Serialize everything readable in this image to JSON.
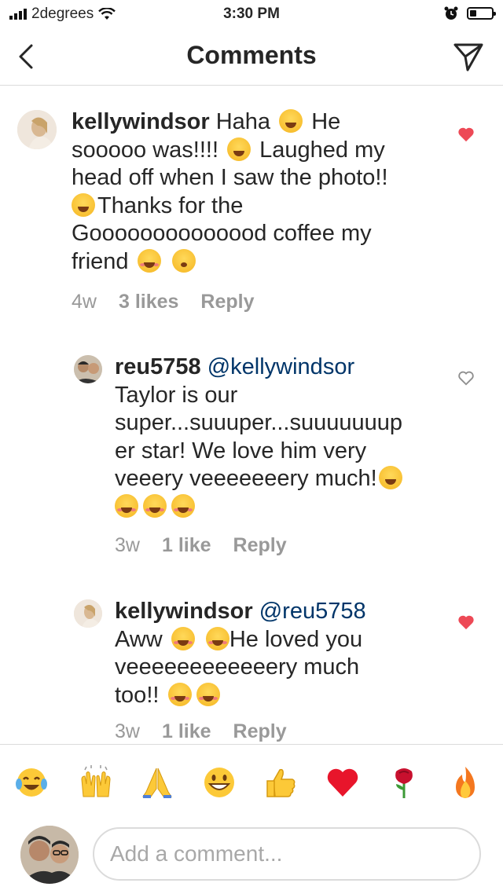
{
  "status_bar": {
    "carrier": "2degrees",
    "time": "3:30 PM"
  },
  "nav": {
    "title": "Comments",
    "back_icon": "chevron-left-icon",
    "send_icon": "direct-send-icon"
  },
  "comments": [
    {
      "username": "kellywindsor",
      "lines": [
        "Haha",
        "He",
        "sooooo was!!!!",
        "Laughed my",
        "head off when I saw the photo!!",
        "Thanks for the",
        "Goooooooooooood coffee my",
        "friend"
      ],
      "time": "4w",
      "likes": "3 likes",
      "reply": "Reply",
      "liked": true
    },
    {
      "username": "reu5758",
      "mention": "@kellywindsor",
      "lines": [
        "Taylor is our",
        "super...suuuper...suuuuuuup",
        "er star! We love him very",
        "veeery veeeeeeery much!"
      ],
      "time": "3w",
      "likes": "1 like",
      "reply": "Reply",
      "liked": false
    },
    {
      "username": "kellywindsor",
      "mention": "@reu5758",
      "lines": [
        "Aww",
        "He loved you",
        "veeeeeeeeeeeery much",
        "too!!"
      ],
      "time": "3w",
      "likes": "1 like",
      "reply": "Reply",
      "liked": true
    }
  ],
  "quick_emojis": [
    "tears-of-joy-emoji",
    "raised-hands-emoji",
    "folded-hands-emoji",
    "grinning-face-emoji",
    "thumbs-up-emoji",
    "red-heart-emoji",
    "rose-emoji",
    "fire-emoji"
  ],
  "composer": {
    "placeholder": "Add a comment..."
  },
  "colors": {
    "liked_heart": "#ed4956",
    "muted_text": "#999999",
    "mention": "#003569"
  }
}
